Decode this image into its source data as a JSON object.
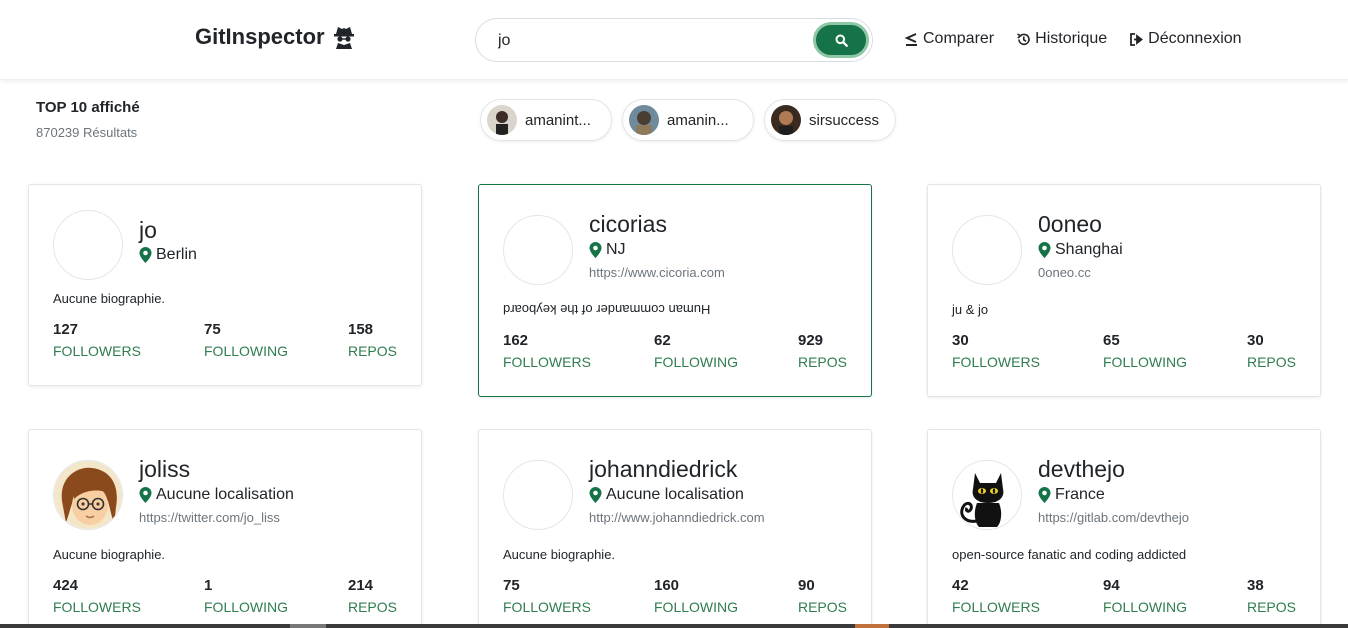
{
  "header": {
    "brand": "GitInspector",
    "search_value": "jo",
    "nav": [
      {
        "label": "Comparer",
        "icon": "compare-icon"
      },
      {
        "label": "Historique",
        "icon": "history-icon"
      },
      {
        "label": "Déconnexion",
        "icon": "logout-icon"
      }
    ]
  },
  "summary": {
    "title": "TOP 10 affiché",
    "count": "870239 Résultats"
  },
  "recent": [
    {
      "label": "amanint..."
    },
    {
      "label": "amanin..."
    },
    {
      "label": "sirsuccess"
    }
  ],
  "cards": [
    {
      "login": "jo",
      "location": "Berlin",
      "blog": "",
      "bio": "Aucune biographie.",
      "followers": "127",
      "following": "75",
      "repos": "158"
    },
    {
      "login": "cicorias",
      "location": "NJ",
      "blog": "https://www.cicoria.com",
      "bio": "Human commander of the keyboard",
      "followers": "162",
      "following": "62",
      "repos": "929"
    },
    {
      "login": "0oneo",
      "location": "Shanghai",
      "blog": "0oneo.cc",
      "bio": "ju & jo",
      "followers": "30",
      "following": "65",
      "repos": "30"
    },
    {
      "login": "joliss",
      "location": "Aucune localisation",
      "blog": "https://twitter.com/jo_liss",
      "bio": "Aucune biographie.",
      "followers": "424",
      "following": "1",
      "repos": "214"
    },
    {
      "login": "johanndiedrick",
      "location": "Aucune localisation",
      "blog": "http://www.johanndiedrick.com",
      "bio": "Aucune biographie.",
      "followers": "75",
      "following": "160",
      "repos": "90"
    },
    {
      "login": "devthejo",
      "location": "France",
      "blog": "https://gitlab.com/devthejo",
      "bio": "open-source fanatic and coding addicted",
      "followers": "42",
      "following": "94",
      "repos": "38"
    }
  ],
  "labels": {
    "followers": "FOLLOWERS",
    "following": "FOLLOWING",
    "repos": "REPOS"
  },
  "colors": {
    "accent": "#157347",
    "stat_label": "#2f7d4f"
  }
}
